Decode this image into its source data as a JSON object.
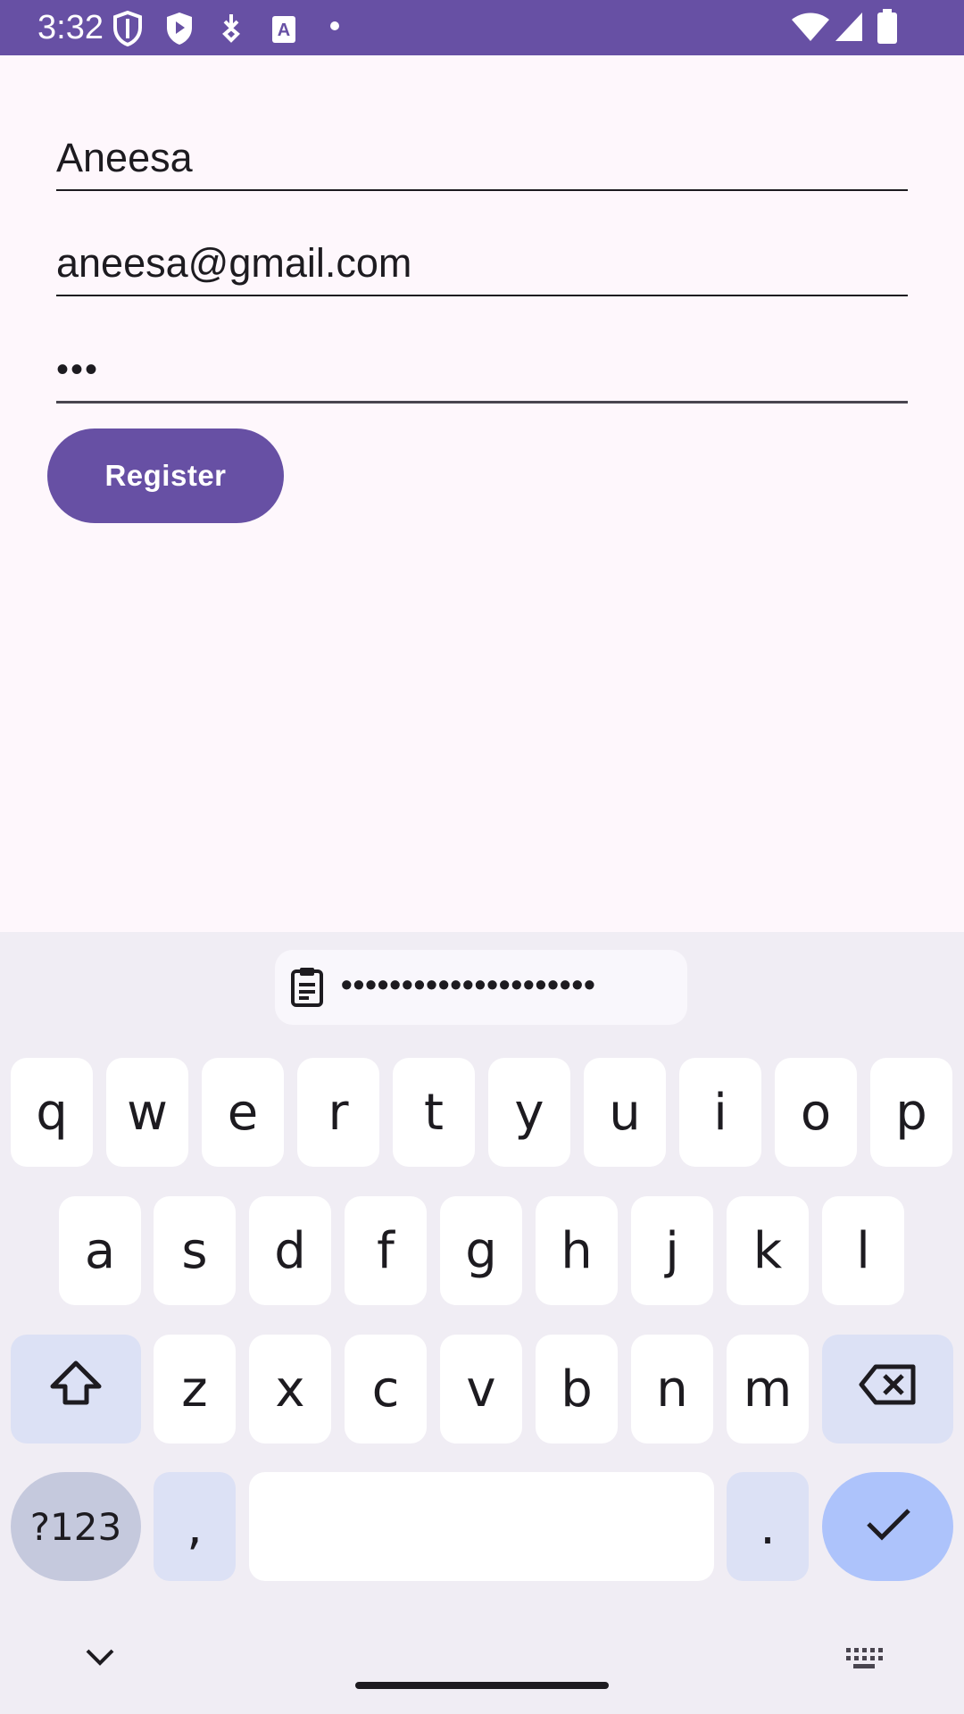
{
  "status_bar": {
    "time": "3:32",
    "icons_left": [
      "shield-outline-icon",
      "shield-play-icon",
      "download-icon",
      "a-box-icon",
      "dot-icon"
    ],
    "icons_right": [
      "wifi-icon",
      "signal-icon",
      "battery-icon"
    ],
    "bg_color": "#6750a4"
  },
  "form": {
    "name_value": "Aneesa",
    "email_value": "aneesa@gmail.com",
    "password_value": "•••",
    "register_label": "Register"
  },
  "keyboard": {
    "clipboard_text": "•••••••••••••••••••••",
    "row1": [
      "q",
      "w",
      "e",
      "r",
      "t",
      "y",
      "u",
      "i",
      "o",
      "p"
    ],
    "row2": [
      "a",
      "s",
      "d",
      "f",
      "g",
      "h",
      "j",
      "k",
      "l"
    ],
    "row3": [
      "z",
      "x",
      "c",
      "v",
      "b",
      "n",
      "m"
    ],
    "symbols_label": "?123",
    "comma_label": ",",
    "period_label": "."
  }
}
